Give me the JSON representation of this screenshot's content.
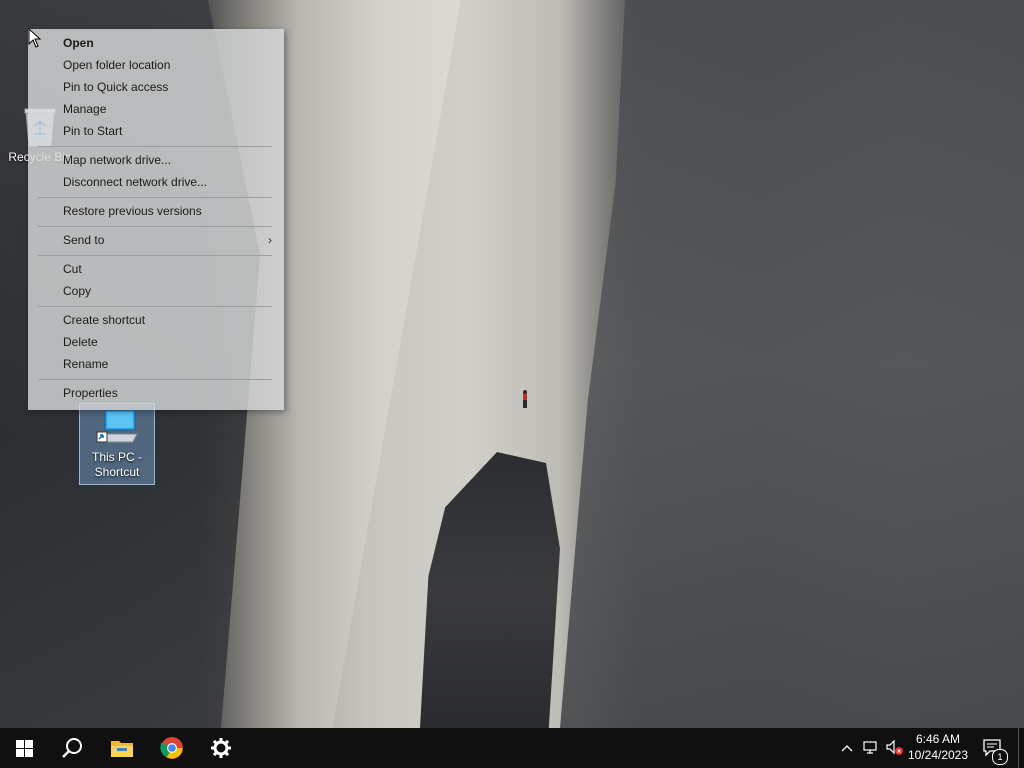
{
  "desktop": {
    "icons": [
      {
        "label": "Recycle Bin"
      },
      {
        "label": "This PC -\nShortcut"
      }
    ]
  },
  "context_menu": {
    "items": [
      {
        "label": "Open",
        "bold": true
      },
      {
        "label": "Open folder location"
      },
      {
        "label": "Pin to Quick access"
      },
      {
        "label": "Manage"
      },
      {
        "label": "Pin to Start"
      },
      {
        "label": "Map network drive..."
      },
      {
        "label": "Disconnect network drive..."
      },
      {
        "label": "Restore previous versions"
      },
      {
        "label": "Send to",
        "submenu": true
      },
      {
        "label": "Cut"
      },
      {
        "label": "Copy"
      },
      {
        "label": "Create shortcut"
      },
      {
        "label": "Delete"
      },
      {
        "label": "Rename"
      },
      {
        "label": "Properties"
      }
    ]
  },
  "taskbar": {
    "start_icon": "windows-logo-icon",
    "pinned": [
      "search-icon",
      "file-explorer-icon",
      "chrome-icon",
      "settings-icon"
    ],
    "tray": {
      "time": "6:46 AM",
      "date": "10/24/2023",
      "notification_count": "1"
    }
  }
}
